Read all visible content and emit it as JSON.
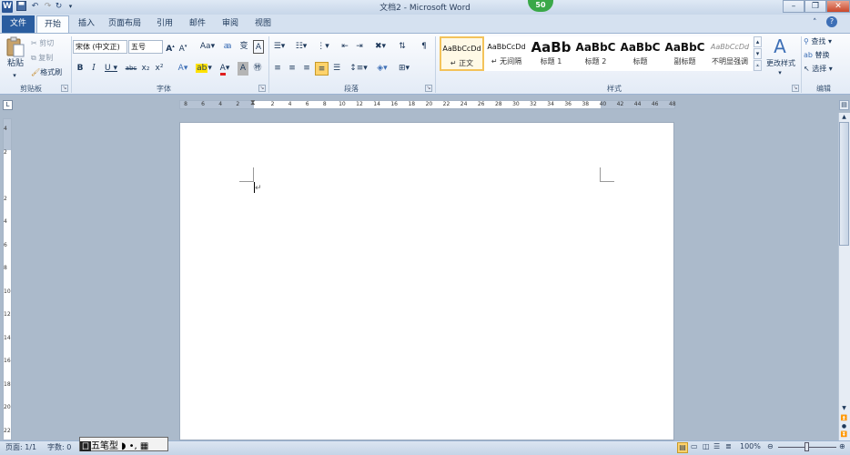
{
  "window": {
    "title": "文档2 - Microsoft Word",
    "badge": "50"
  },
  "quickaccess": {
    "logo": "W"
  },
  "tabs": [
    "文件",
    "开始",
    "插入",
    "页面布局",
    "引用",
    "邮件",
    "审阅",
    "视图"
  ],
  "clipboard": {
    "paste": "粘贴",
    "cut": "剪切",
    "copy": "复制",
    "painter": "格式刷",
    "label": "剪贴板"
  },
  "font": {
    "name": "宋体 (中文正)",
    "size": "五号",
    "label": "字体"
  },
  "paragraph": {
    "label": "段落"
  },
  "styles": {
    "label": "样式",
    "items": [
      {
        "sample": "AaBbCcDd",
        "name": "↵ 正文"
      },
      {
        "sample": "AaBbCcDd",
        "name": "↵ 无间隔"
      },
      {
        "sample": "AaBb",
        "name": "标题 1"
      },
      {
        "sample": "AaBbC",
        "name": "标题 2"
      },
      {
        "sample": "AaBbC",
        "name": "标题"
      },
      {
        "sample": "AaBbC",
        "name": "副标题"
      },
      {
        "sample": "AaBbCcDd",
        "name": "不明显强调"
      }
    ],
    "change": "更改样式"
  },
  "editing": {
    "find": "查找",
    "replace": "替换",
    "select": "选择",
    "label": "编辑"
  },
  "ruler": {
    "ticks": [
      "8",
      "6",
      "4",
      "2",
      "",
      "2",
      "4",
      "6",
      "8",
      "10",
      "12",
      "14",
      "16",
      "18",
      "20",
      "22",
      "24",
      "26",
      "28",
      "30",
      "32",
      "34",
      "36",
      "38",
      "40",
      "42",
      "44",
      "46",
      "48"
    ]
  },
  "vruler": {
    "ticks": [
      "4",
      "2",
      "",
      "2",
      "4",
      "6",
      "8",
      "10",
      "12",
      "14",
      "16",
      "18",
      "20",
      "22"
    ]
  },
  "status": {
    "page": "页面: 1/1",
    "words": "字数: 0",
    "zoom": "100%"
  },
  "ime": {
    "label": "五笔型"
  },
  "colors": {
    "accent": "#2a5d9f",
    "badge": "#3aa848"
  }
}
